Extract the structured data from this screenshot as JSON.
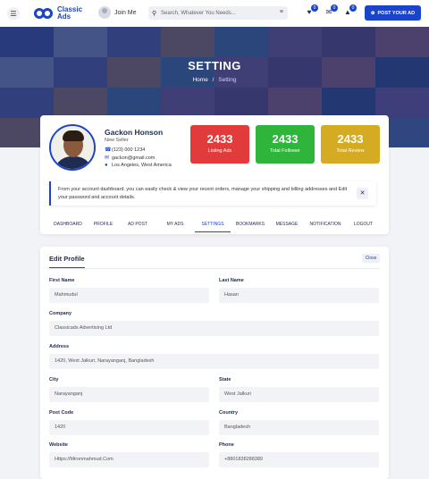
{
  "header": {
    "logo_line1": "Classic",
    "logo_line2": "Ads",
    "join_label": "Join Me",
    "search_placeholder": "Search, Whatever You Needs...",
    "badges": {
      "favorites": "0",
      "messages": "0",
      "notifications": "0"
    },
    "post_button": "POST YOUR AD"
  },
  "hero": {
    "title": "SETTING",
    "breadcrumb_home": "Home",
    "breadcrumb_separator": "/",
    "breadcrumb_current": "Setting"
  },
  "profile": {
    "name": "Gackon Honson",
    "role": "New Seller",
    "phone": "(123) 000 1234",
    "email": "gackon@gmail.com",
    "location": "Los Angeles, West America"
  },
  "stats": [
    {
      "value": "2433",
      "label": "Listing Ads",
      "color": "#e23b3b"
    },
    {
      "value": "2433",
      "label": "Total Follower",
      "color": "#2fb53c"
    },
    {
      "value": "2433",
      "label": "Total Review",
      "color": "#d4ab23"
    }
  ],
  "notice": {
    "text": "From your account dashboard. you can easily check & view your recent orders, manage your shipping and billing addresses and Edit your password and account details."
  },
  "tabs": [
    "DASHBOARD",
    "PROFILE",
    "AD POST",
    "MY ADS",
    "SETTINGS",
    "BOOKMARKS",
    "MESSAGE",
    "NOTIFICATION",
    "LOGOUT"
  ],
  "active_tab": "SETTINGS",
  "form": {
    "title": "Edit Profile",
    "close_label": "Close",
    "fields": {
      "first_name": {
        "label": "First Name",
        "value": "Mahmudul"
      },
      "last_name": {
        "label": "Last Name",
        "value": "Hasan"
      },
      "company": {
        "label": "Company",
        "value": "Classicads Advertising Ltd"
      },
      "address": {
        "label": "Address",
        "value": "1420, West Jalkuri, Narayanganj, Bangladesh"
      },
      "city": {
        "label": "City",
        "value": "Narayanganj"
      },
      "state": {
        "label": "State",
        "value": "West Jalkuri"
      },
      "post_code": {
        "label": "Post Code",
        "value": "1420"
      },
      "country": {
        "label": "Country",
        "value": "Bangladesh"
      },
      "website": {
        "label": "Website",
        "value": "Https://Mironmahmud.Com"
      },
      "phone": {
        "label": "Phone",
        "value": "+8801838288389"
      }
    }
  },
  "colors": {
    "primary": "#1a44c9",
    "dark": "#1d2b4f",
    "page_bg": "#f2f3f6"
  }
}
